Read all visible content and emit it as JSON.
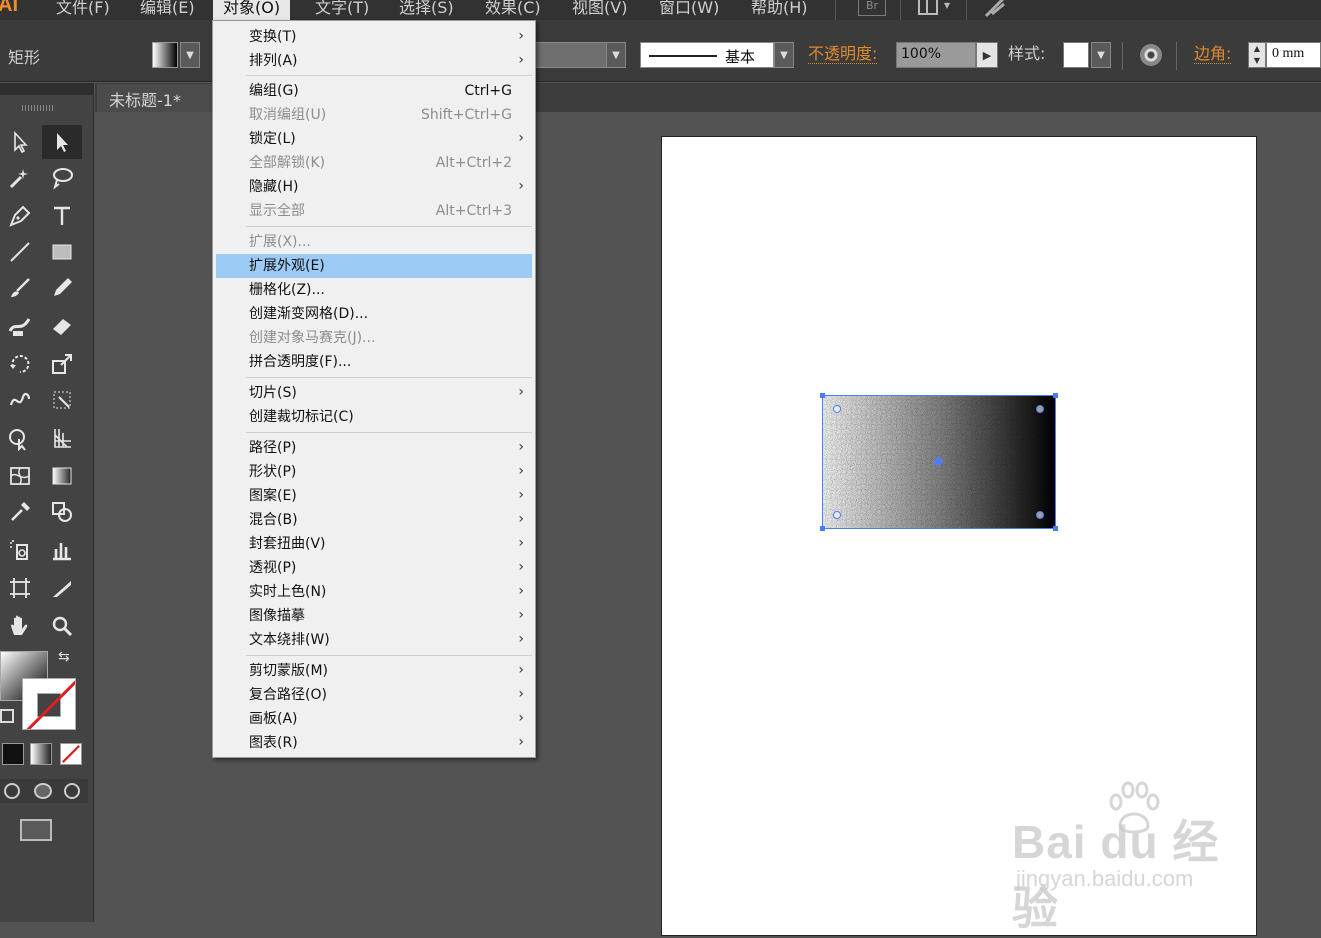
{
  "menubar": {
    "logo": "AI",
    "items": [
      "文件(F)",
      "编辑(E)",
      "对象(O)",
      "文字(T)",
      "选择(S)",
      "效果(C)",
      "视图(V)",
      "窗口(W)",
      "帮助(H)"
    ],
    "bridge_label": "Br"
  },
  "controlbar": {
    "tool_name": "矩形",
    "brush_label": "基本",
    "opacity_label": "不透明度:",
    "opacity_value": "100%",
    "style_label": "样式:",
    "corner_label": "边角:",
    "corner_value": "0 mm"
  },
  "document": {
    "tab_title": "未标题-1* @"
  },
  "menu": {
    "title": "对象(O)",
    "items": [
      {
        "label": "变换(T)",
        "shortcut": "",
        "submenu": true,
        "enabled": true
      },
      {
        "label": "排列(A)",
        "shortcut": "",
        "submenu": true,
        "enabled": true
      },
      {
        "label": "编组(G)",
        "shortcut": "Ctrl+G",
        "submenu": false,
        "enabled": true
      },
      {
        "label": "取消编组(U)",
        "shortcut": "Shift+Ctrl+G",
        "submenu": false,
        "enabled": false
      },
      {
        "label": "锁定(L)",
        "shortcut": "",
        "submenu": true,
        "enabled": true
      },
      {
        "label": "全部解锁(K)",
        "shortcut": "Alt+Ctrl+2",
        "submenu": false,
        "enabled": false
      },
      {
        "label": "隐藏(H)",
        "shortcut": "",
        "submenu": true,
        "enabled": true
      },
      {
        "label": "显示全部",
        "shortcut": "Alt+Ctrl+3",
        "submenu": false,
        "enabled": false
      },
      {
        "label": "扩展(X)...",
        "shortcut": "",
        "submenu": false,
        "enabled": false
      },
      {
        "label": "扩展外观(E)",
        "shortcut": "",
        "submenu": false,
        "enabled": true,
        "highlighted": true
      },
      {
        "label": "栅格化(Z)...",
        "shortcut": "",
        "submenu": false,
        "enabled": true
      },
      {
        "label": "创建渐变网格(D)...",
        "shortcut": "",
        "submenu": false,
        "enabled": true
      },
      {
        "label": "创建对象马赛克(J)...",
        "shortcut": "",
        "submenu": false,
        "enabled": false
      },
      {
        "label": "拼合透明度(F)...",
        "shortcut": "",
        "submenu": false,
        "enabled": true
      },
      {
        "label": "切片(S)",
        "shortcut": "",
        "submenu": true,
        "enabled": true
      },
      {
        "label": "创建裁切标记(C)",
        "shortcut": "",
        "submenu": false,
        "enabled": true
      },
      {
        "label": "路径(P)",
        "shortcut": "",
        "submenu": true,
        "enabled": true
      },
      {
        "label": "形状(P)",
        "shortcut": "",
        "submenu": true,
        "enabled": true
      },
      {
        "label": "图案(E)",
        "shortcut": "",
        "submenu": true,
        "enabled": true
      },
      {
        "label": "混合(B)",
        "shortcut": "",
        "submenu": true,
        "enabled": true
      },
      {
        "label": "封套扭曲(V)",
        "shortcut": "",
        "submenu": true,
        "enabled": true
      },
      {
        "label": "透视(P)",
        "shortcut": "",
        "submenu": true,
        "enabled": true
      },
      {
        "label": "实时上色(N)",
        "shortcut": "",
        "submenu": true,
        "enabled": true
      },
      {
        "label": "图像描摹",
        "shortcut": "",
        "submenu": true,
        "enabled": true
      },
      {
        "label": "文本绕排(W)",
        "shortcut": "",
        "submenu": true,
        "enabled": true
      },
      {
        "label": "剪切蒙版(M)",
        "shortcut": "",
        "submenu": true,
        "enabled": true
      },
      {
        "label": "复合路径(O)",
        "shortcut": "",
        "submenu": true,
        "enabled": true
      },
      {
        "label": "画板(A)",
        "shortcut": "",
        "submenu": true,
        "enabled": true
      },
      {
        "label": "图表(R)",
        "shortcut": "",
        "submenu": true,
        "enabled": true
      }
    ],
    "submenu_arrow": "›"
  },
  "watermark": {
    "brand": "Bai du 经验",
    "url": "jingyan.baidu.com"
  },
  "colors": {
    "accent_link": "#e08a2e",
    "selection": "#4a7cff",
    "menu_highlight": "#9ccbf5"
  },
  "tools": [
    "selection-icon",
    "direct-selection-icon",
    "magic-wand-icon",
    "lasso-icon",
    "pen-icon",
    "type-icon",
    "line-icon",
    "rectangle-icon",
    "paintbrush-icon",
    "pencil-icon",
    "blob-brush-icon",
    "eraser-icon",
    "rotate-icon",
    "scale-icon",
    "warp-icon",
    "free-transform-icon",
    "shape-builder-icon",
    "perspective-grid-icon",
    "mesh-icon",
    "gradient-icon",
    "eyedropper-icon",
    "blend-icon",
    "symbol-sprayer-icon",
    "column-graph-icon",
    "artboard-icon",
    "slice-icon",
    "hand-icon",
    "zoom-icon"
  ]
}
